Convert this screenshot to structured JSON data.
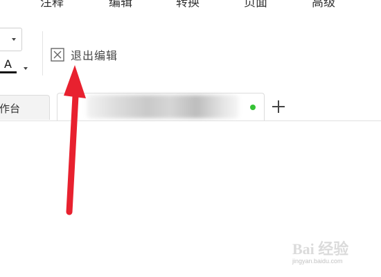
{
  "menu": [
    {
      "id": "annotate",
      "label": "注释"
    },
    {
      "id": "edit",
      "label": "编辑"
    },
    {
      "id": "convert",
      "label": "转换"
    },
    {
      "id": "page",
      "label": "页面"
    },
    {
      "id": "advanced",
      "label": "高级"
    }
  ],
  "toolbar": {
    "font_color_letter": "A",
    "exit_edit_label": "退出编辑"
  },
  "tabs": {
    "workbench_label": "作台",
    "doc_status_color": "#35c235",
    "add_tab_label": "+"
  },
  "colors": {
    "annotation_arrow": "#e8212f"
  },
  "watermark": {
    "text": "Bai 经验",
    "sub": "jingyan.baidu.com"
  }
}
